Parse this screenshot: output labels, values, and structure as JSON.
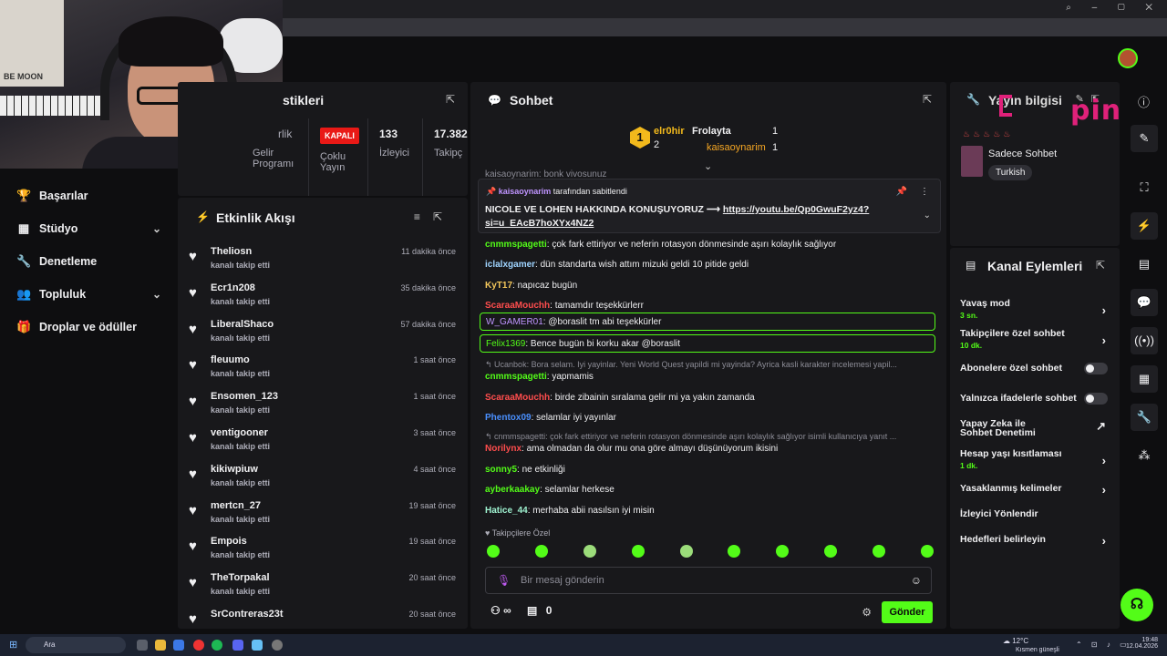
{
  "nav": [
    {
      "label": "Başarılar",
      "icon": "trophy-icon",
      "glyph": "🏆",
      "chev": ""
    },
    {
      "label": "Stüdyo",
      "icon": "studio-icon",
      "glyph": "▦",
      "chev": "⌄"
    },
    {
      "label": "Denetleme",
      "icon": "wrench-icon",
      "glyph": "🔧",
      "chev": ""
    },
    {
      "label": "Topluluk",
      "icon": "people-icon",
      "glyph": "👥",
      "chev": "⌄"
    },
    {
      "label": "Droplar ve ödüller",
      "icon": "gift-icon",
      "glyph": "🎁",
      "chev": ""
    }
  ],
  "stats": {
    "title": "stikleri",
    "col1": "Gelir Programı",
    "col1_label": "rlik",
    "col2_badge": "KAPALI",
    "col2_label": "Çoklu Yayın",
    "col3_value": "133",
    "col3_label": "İzleyici",
    "col4_value": "17.382",
    "col4_label": "Takipç"
  },
  "feed": {
    "title": "Etkinlik Akışı",
    "items": [
      {
        "name": "Theliosn",
        "act": "kanalı takip etti",
        "time": "11 dakika önce"
      },
      {
        "name": "Ecr1n208",
        "act": "kanalı takip etti",
        "time": "35 dakika önce"
      },
      {
        "name": "LiberalShaco",
        "act": "kanalı takip etti",
        "time": "57 dakika önce"
      },
      {
        "name": "fleuumo",
        "act": "kanalı takip etti",
        "time": "1 saat önce"
      },
      {
        "name": "Ensomen_123",
        "act": "kanalı takip etti",
        "time": "1 saat önce"
      },
      {
        "name": "ventigooner",
        "act": "kanalı takip etti",
        "time": "3 saat önce"
      },
      {
        "name": "kikiwpiuw",
        "act": "kanalı takip etti",
        "time": "4 saat önce"
      },
      {
        "name": "mertcn_27",
        "act": "kanalı takip etti",
        "time": "19 saat önce"
      },
      {
        "name": "Empois",
        "act": "kanalı takip etti",
        "time": "19 saat önce"
      },
      {
        "name": "TheTorpakal",
        "act": "kanalı takip etti",
        "time": "20 saat önce"
      },
      {
        "name": "SrContreras23t",
        "act": "",
        "time": "20 saat önce"
      }
    ]
  },
  "chat": {
    "title": "Sohbet",
    "leader": {
      "rank": "1",
      "first": "elr0hir",
      "first_count": "2",
      "second": "Frolayta",
      "second_count": "1",
      "third": "kaisaoynarim",
      "third_count": "1"
    },
    "pinned": {
      "by": "kaisaoynarim",
      "by_suffix": " tarafından sabitlendi",
      "text": "NICOLE VE LOHEN HAKKINDA KONUŞUYORUZ ⟶ ",
      "link": "https://youtu.be/Qp0GwuF2yz4?si=u_EAcB7hoXYx4NZ2"
    },
    "cut_top": "kaisaoynarim: bonk vivosunuz",
    "messages": [
      {
        "user": "cnmmspagetti",
        "color": "#53fc18",
        "text": ": çok fark ettiriyor ve neferin rotasyon dönmesinde aşırı kolaylık sağlıyor"
      },
      {
        "user": "iclalxgamer",
        "color": "#9fd4ff",
        "text": ": dün standarta wish attım mizuki geldi 10 pitide geldi"
      },
      {
        "user": "KyT17",
        "color": "#f5c85b",
        "text": ": napıcaz bugün"
      },
      {
        "user": "ScaraaMouchh",
        "color": "#ff4d4d",
        "text": ": tamamdır teşekkürlerr"
      }
    ],
    "highlight1": {
      "user": "W_GAMER01",
      "color": "#bf94ff",
      "text": ": @boraslit tm abi teşekkürler"
    },
    "highlight2": {
      "user": "Felix1369",
      "color": "#53fc18",
      "text": ": Bence bugün bi korku akar @boraslit"
    },
    "reply1": "↰ Ucanbok: Bora selam. Iyi yayinlar. Yeni World Quest yapildi mi yayinda? Ayrica kasli karakter incelemesi yapil...",
    "messages2": [
      {
        "user": "cnmmspagetti",
        "color": "#53fc18",
        "text": ": yapmamis"
      },
      {
        "user": "ScaraaMouchh",
        "color": "#ff4d4d",
        "text": ": birde zibainin sıralama gelir mi ya yakın zamanda"
      },
      {
        "user": "Phentox09",
        "color": "#4a90ff",
        "text": ": selamlar iyi yayınlar"
      }
    ],
    "reply2": "↰ cnmmspagetti: çok fark ettiriyor ve neferin rotasyon dönmesinde aşırı kolaylık sağlıyor isimli kullanıcıya yanıt ...",
    "messages3": [
      {
        "user": "Norilynx",
        "color": "#ff4d4d",
        "text": ": ama olmadan da olur mu ona göre almayı düşünüyorum ikisini"
      },
      {
        "user": "sonny5",
        "color": "#53fc18",
        "text": ": ne etkinliği"
      },
      {
        "user": "ayberkaakay",
        "color": "#53fc18",
        "text": ": selamlar herkese"
      },
      {
        "user": "Hatice_44",
        "color": "#9ff2d0",
        "text": ": merhaba abii nasılsın iyi misin"
      }
    ],
    "follow_only": "♥ Takipçilere Özel",
    "placeholder": "Bir mesaj gönderin",
    "foot_count": "0",
    "send": "Gönder"
  },
  "info": {
    "title": "Yayın bilgisi",
    "category": "Sadece Sohbet",
    "tag": "Turkish"
  },
  "logo_text": "pin",
  "actions": {
    "title": "Kanal Eylemleri",
    "items": [
      {
        "label": "Yavaş mod",
        "sub": "3 sn.",
        "ctrl": "›"
      },
      {
        "label": "Takipçilere özel sohbet",
        "sub": "10 dk.",
        "ctrl": "›"
      },
      {
        "label": "Abonelere özel sohbet",
        "sub": "",
        "ctrl": "toggle"
      },
      {
        "label": "Yalnızca ifadelerle sohbet",
        "sub": "",
        "ctrl": "toggle"
      },
      {
        "label": "Yapay Zeka ile Sohbet Denetimi",
        "sub": "",
        "ctrl": "↗"
      },
      {
        "label": "Hesap yaşı kısıtlaması",
        "sub": "1 dk.",
        "ctrl": "›"
      },
      {
        "label": "Yasaklanmış kelimeler",
        "sub": "",
        "ctrl": "›"
      },
      {
        "label": "İzleyici Yönlendir",
        "sub": "",
        "ctrl": ""
      },
      {
        "label": "Hedefleri belirleyin",
        "sub": "",
        "ctrl": "›"
      }
    ]
  },
  "taskbar": {
    "search": "Ara",
    "weather": "12°C",
    "weather_sub": "Kısmen güneşli",
    "time": "19:48",
    "date": "12.04.2026"
  },
  "colors": {
    "accent": "#53fc18",
    "panel": "#18181b",
    "bg": "#0e0e10"
  }
}
